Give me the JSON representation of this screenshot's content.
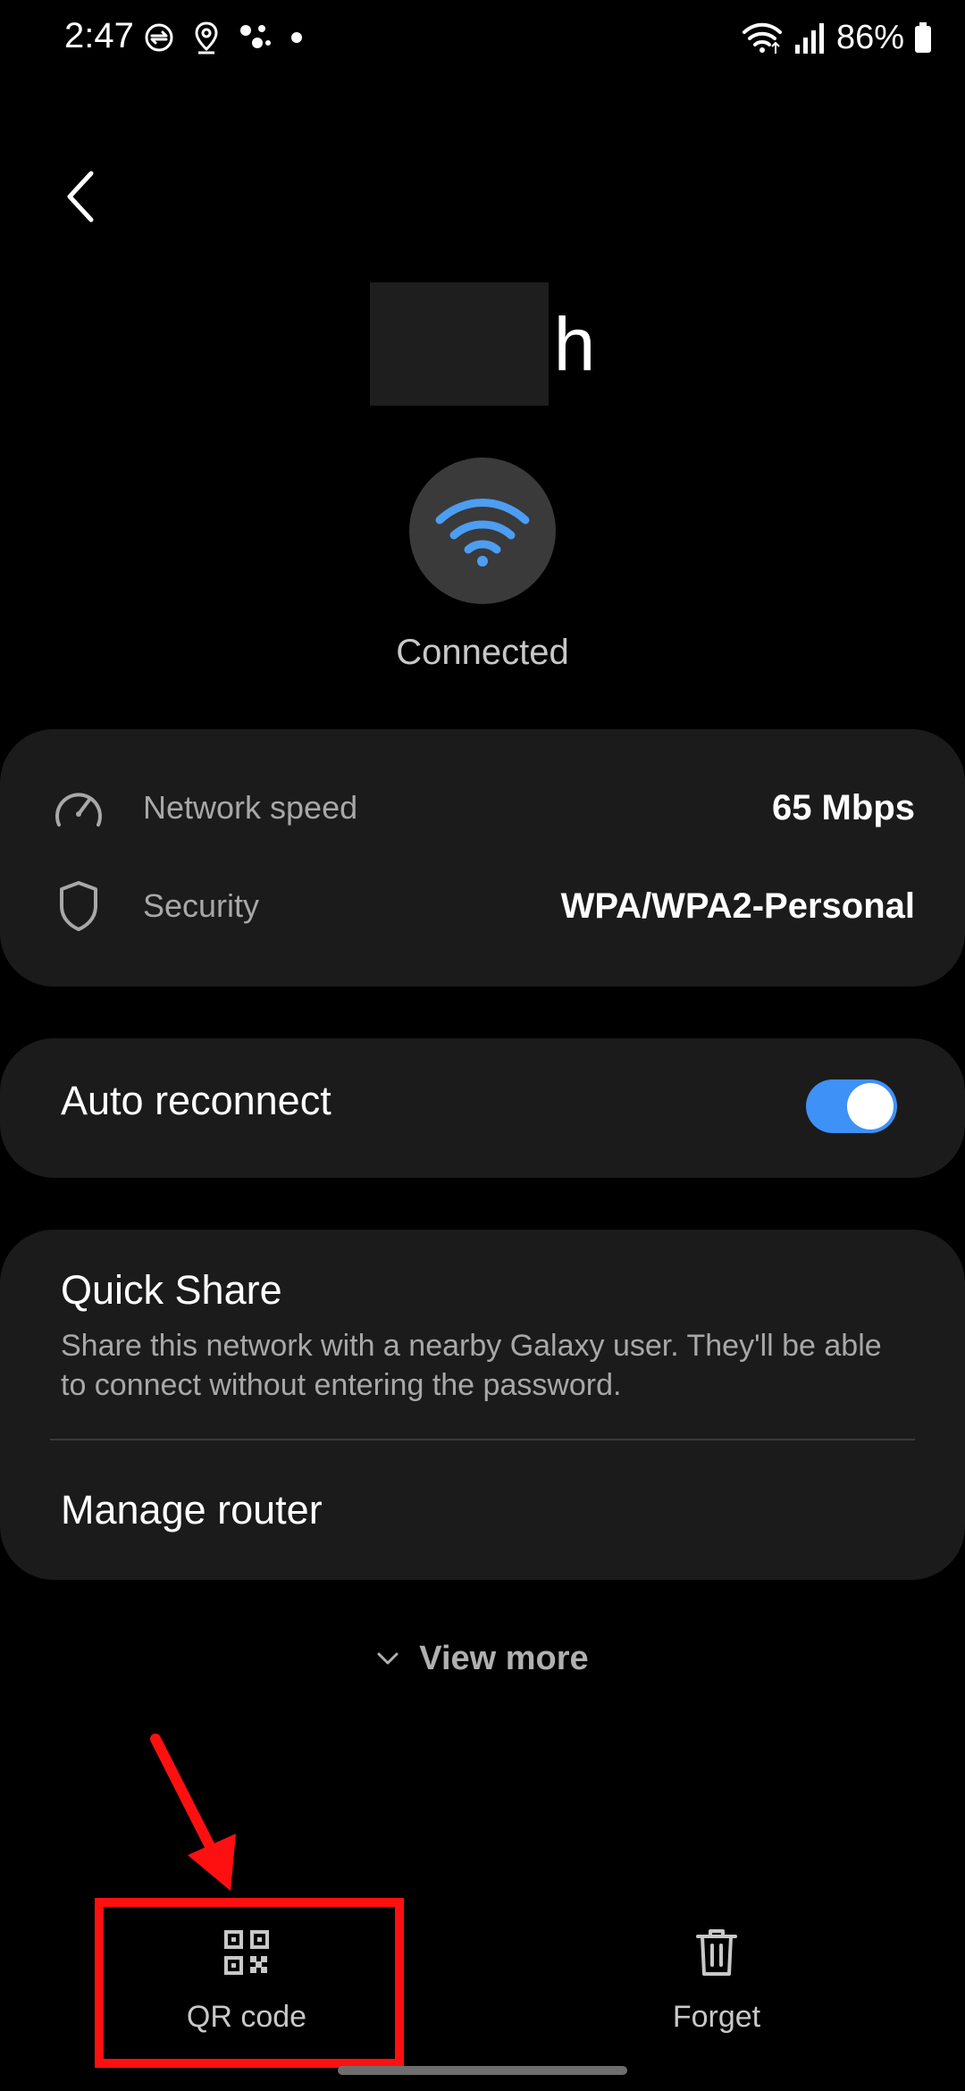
{
  "status_bar": {
    "time": "2:47",
    "battery": "86%",
    "left_icons": [
      "sync-icon",
      "location-icon",
      "assistant-dots-icon",
      "dot-icon"
    ],
    "right_icons": [
      "wifi-signal-icon",
      "cell-signal-icon",
      "battery-icon"
    ]
  },
  "header": {
    "back_icon": "chevron-left-icon",
    "network_name_visible": "h"
  },
  "connection": {
    "icon": "wifi-icon",
    "status": "Connected"
  },
  "info": {
    "rows": [
      {
        "icon": "speedometer-icon",
        "label": "Network speed",
        "value": "65 Mbps"
      },
      {
        "icon": "shield-icon",
        "label": "Security",
        "value": "WPA/WPA2-Personal"
      }
    ]
  },
  "auto_reconnect": {
    "label": "Auto reconnect",
    "enabled": true
  },
  "share": {
    "title": "Quick Share",
    "description": "Share this network with a nearby Galaxy user. They'll be able to connect without entering the password.",
    "manage_router": "Manage router"
  },
  "view_more": {
    "label": "View more",
    "icon": "chevron-down-icon"
  },
  "bottom_actions": {
    "qr_code": {
      "label": "QR code",
      "icon": "qr-code-icon"
    },
    "forget": {
      "label": "Forget",
      "icon": "trash-icon"
    }
  },
  "colors": {
    "accent": "#3e91f7",
    "wifi_blue": "#4d9df2",
    "annotation_red": "#ff1010",
    "card_bg": "#1b1b1b"
  }
}
